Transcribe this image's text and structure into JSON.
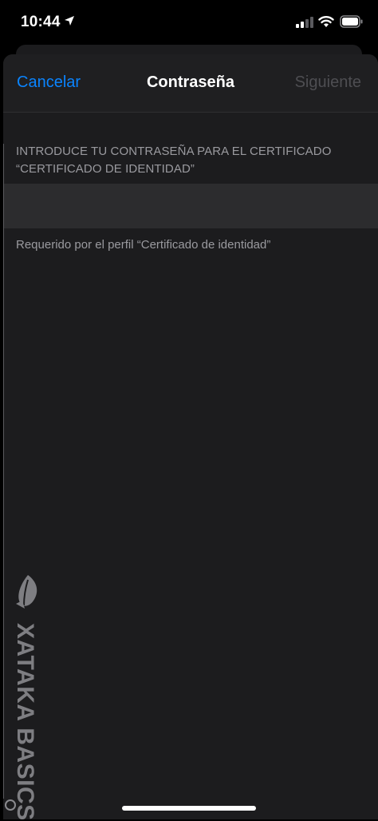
{
  "status_bar": {
    "time": "10:44",
    "location_icon": "location-arrow-icon",
    "signal_icon": "cellular-signal-icon",
    "wifi_icon": "wifi-icon",
    "battery_icon": "battery-icon"
  },
  "nav": {
    "cancel_label": "Cancelar",
    "title": "Contraseña",
    "next_label": "Siguiente"
  },
  "form": {
    "header": "INTRODUCE TU CONTRASEÑA PARA EL CERTIFICADO “CERTIFICADO DE IDENTIDAD”",
    "password_value": "",
    "footer": "Requerido por el perfil “Certificado de identidad”"
  },
  "watermark": {
    "text": "XATAKA BASICS",
    "logo_icon": "xataka-leaf-icon"
  },
  "colors": {
    "accent": "#0a84ff",
    "disabled": "#4e4e52",
    "sheet_bg": "#1c1c1e",
    "row_bg": "#2c2c2e",
    "secondary_text": "#9a9a9f"
  }
}
